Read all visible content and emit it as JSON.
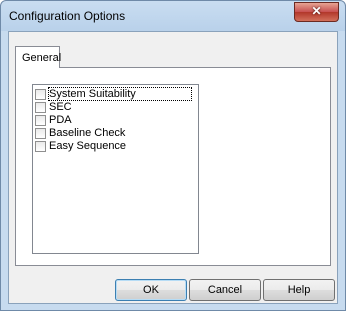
{
  "window": {
    "title": "Configuration Options",
    "close_glyph": "✕"
  },
  "tabs": [
    {
      "label": "General",
      "selected": true
    }
  ],
  "options": [
    {
      "label": "System Suitability",
      "checked": false,
      "focused": true
    },
    {
      "label": "SEC",
      "checked": false
    },
    {
      "label": "PDA",
      "checked": false
    },
    {
      "label": "Baseline Check",
      "checked": false
    },
    {
      "label": "Easy Sequence",
      "checked": false
    }
  ],
  "buttons": {
    "ok": "OK",
    "cancel": "Cancel",
    "help": "Help"
  }
}
